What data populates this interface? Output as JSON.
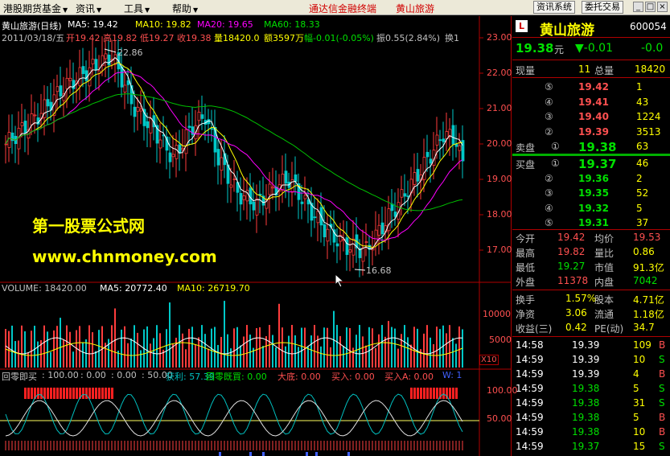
{
  "menu": {
    "items": [
      "港股期货基金",
      "资讯",
      "工具",
      "帮助"
    ],
    "center_title": "通达信金融终端",
    "center_stock": "黄山旅游",
    "buttons": [
      "资讯系统",
      "委托交易"
    ],
    "controls": [
      "_",
      "□",
      "×"
    ]
  },
  "chart": {
    "header": {
      "title": "黄山旅游(日线)",
      "ma5": "MA5: 19.42",
      "ma10": "MA10: 19.82",
      "ma20": "MA20: 19.65",
      "ma60": "MA60: 18.33"
    },
    "info": {
      "date": "2011/03/18/五",
      "open": "开19.42",
      "high": "高19.82",
      "low": "低19.27",
      "close": "收19.38",
      "vol": "量18420.0",
      "amt": "额3597万",
      "chg": "幅-0.01(-0.05%)",
      "amp": "振0.55(2.84%)",
      "turn": "换1"
    },
    "price_axis": [
      "23.00",
      "22.00",
      "21.00",
      "20.00",
      "19.00",
      "18.00",
      "17.00"
    ],
    "max_label": "22.86",
    "min_label": "16.68",
    "watermark_title": "第一股票公式网",
    "watermark_url": "www.chnmoney.com",
    "volume": {
      "label": "VOLUME: 18420.00",
      "ma5": "MA5: 20772.40",
      "ma10": "MA10: 26719.70",
      "axis": [
        "10000",
        "5000"
      ],
      "unit": "X10"
    },
    "indicator": {
      "name": "回零即买",
      "p1": ": 100.00",
      "p2": ": 0.00",
      "p3": ": 0.00",
      "p4": ": 50.00",
      "profit": "获利: 57.39",
      "r2": "回零既買: 0.00",
      "r3": "大底: 0.00",
      "r4": "买入: 0.00",
      "r5": "买入A: 0.00",
      "r6": "W: 1",
      "axis": [
        "100.00",
        "50.00"
      ]
    },
    "colors": {
      "up": "#ff3c3c",
      "down": "#00c8c8",
      "ma5": "#ffffff",
      "ma10": "#ffff00",
      "ma20": "#ff00ff",
      "ma60": "#00c000"
    }
  },
  "quote": {
    "badge": "L",
    "name": "黄山旅游",
    "code": "600054",
    "price": "19.38",
    "unit": "元",
    "change": "▼-0.01",
    "pct": "-0.0",
    "xianliang_label": "现量",
    "xianliang": "11",
    "zongliang_label": "总量",
    "zongliang": "18420",
    "sell": [
      {
        "n": "⑤",
        "p": "19.42",
        "v": "1"
      },
      {
        "n": "④",
        "p": "19.41",
        "v": "43"
      },
      {
        "n": "③",
        "p": "19.40",
        "v": "1224"
      },
      {
        "n": "②",
        "p": "19.39",
        "v": "3513"
      },
      {
        "n": "①",
        "p": "19.38",
        "v": "63"
      }
    ],
    "sell_label": "卖盘",
    "buy_label": "买盘",
    "buy": [
      {
        "n": "①",
        "p": "19.37",
        "v": "46"
      },
      {
        "n": "②",
        "p": "19.36",
        "v": "2"
      },
      {
        "n": "③",
        "p": "19.35",
        "v": "52"
      },
      {
        "n": "④",
        "p": "19.32",
        "v": "5"
      },
      {
        "n": "⑤",
        "p": "19.31",
        "v": "37"
      }
    ],
    "stats": [
      [
        "今开",
        "19.42",
        "均价",
        "19.53"
      ],
      [
        "最高",
        "19.82",
        "量比",
        "0.86"
      ],
      [
        "最低",
        "19.27",
        "市值",
        "91.3亿"
      ],
      [
        "外盘",
        "11378",
        "内盘",
        "7042"
      ]
    ],
    "stats2": [
      [
        "换手",
        "1.57%",
        "股本",
        "4.71亿"
      ],
      [
        "净资",
        "3.06",
        "流通",
        "1.18亿"
      ],
      [
        "收益(三)",
        "0.42",
        "PE(动)",
        "34.7"
      ]
    ],
    "ticks": [
      [
        "14:58",
        "19.39",
        "109",
        "B"
      ],
      [
        "14:59",
        "19.39",
        "10",
        "S"
      ],
      [
        "14:59",
        "19.39",
        "4",
        "B"
      ],
      [
        "14:59",
        "19.38",
        "5",
        "S"
      ],
      [
        "14:59",
        "19.38",
        "31",
        "S"
      ],
      [
        "14:59",
        "19.38",
        "5",
        "B"
      ],
      [
        "14:59",
        "19.38",
        "10",
        "B"
      ],
      [
        "14:59",
        "19.37",
        "15",
        "S"
      ]
    ]
  }
}
